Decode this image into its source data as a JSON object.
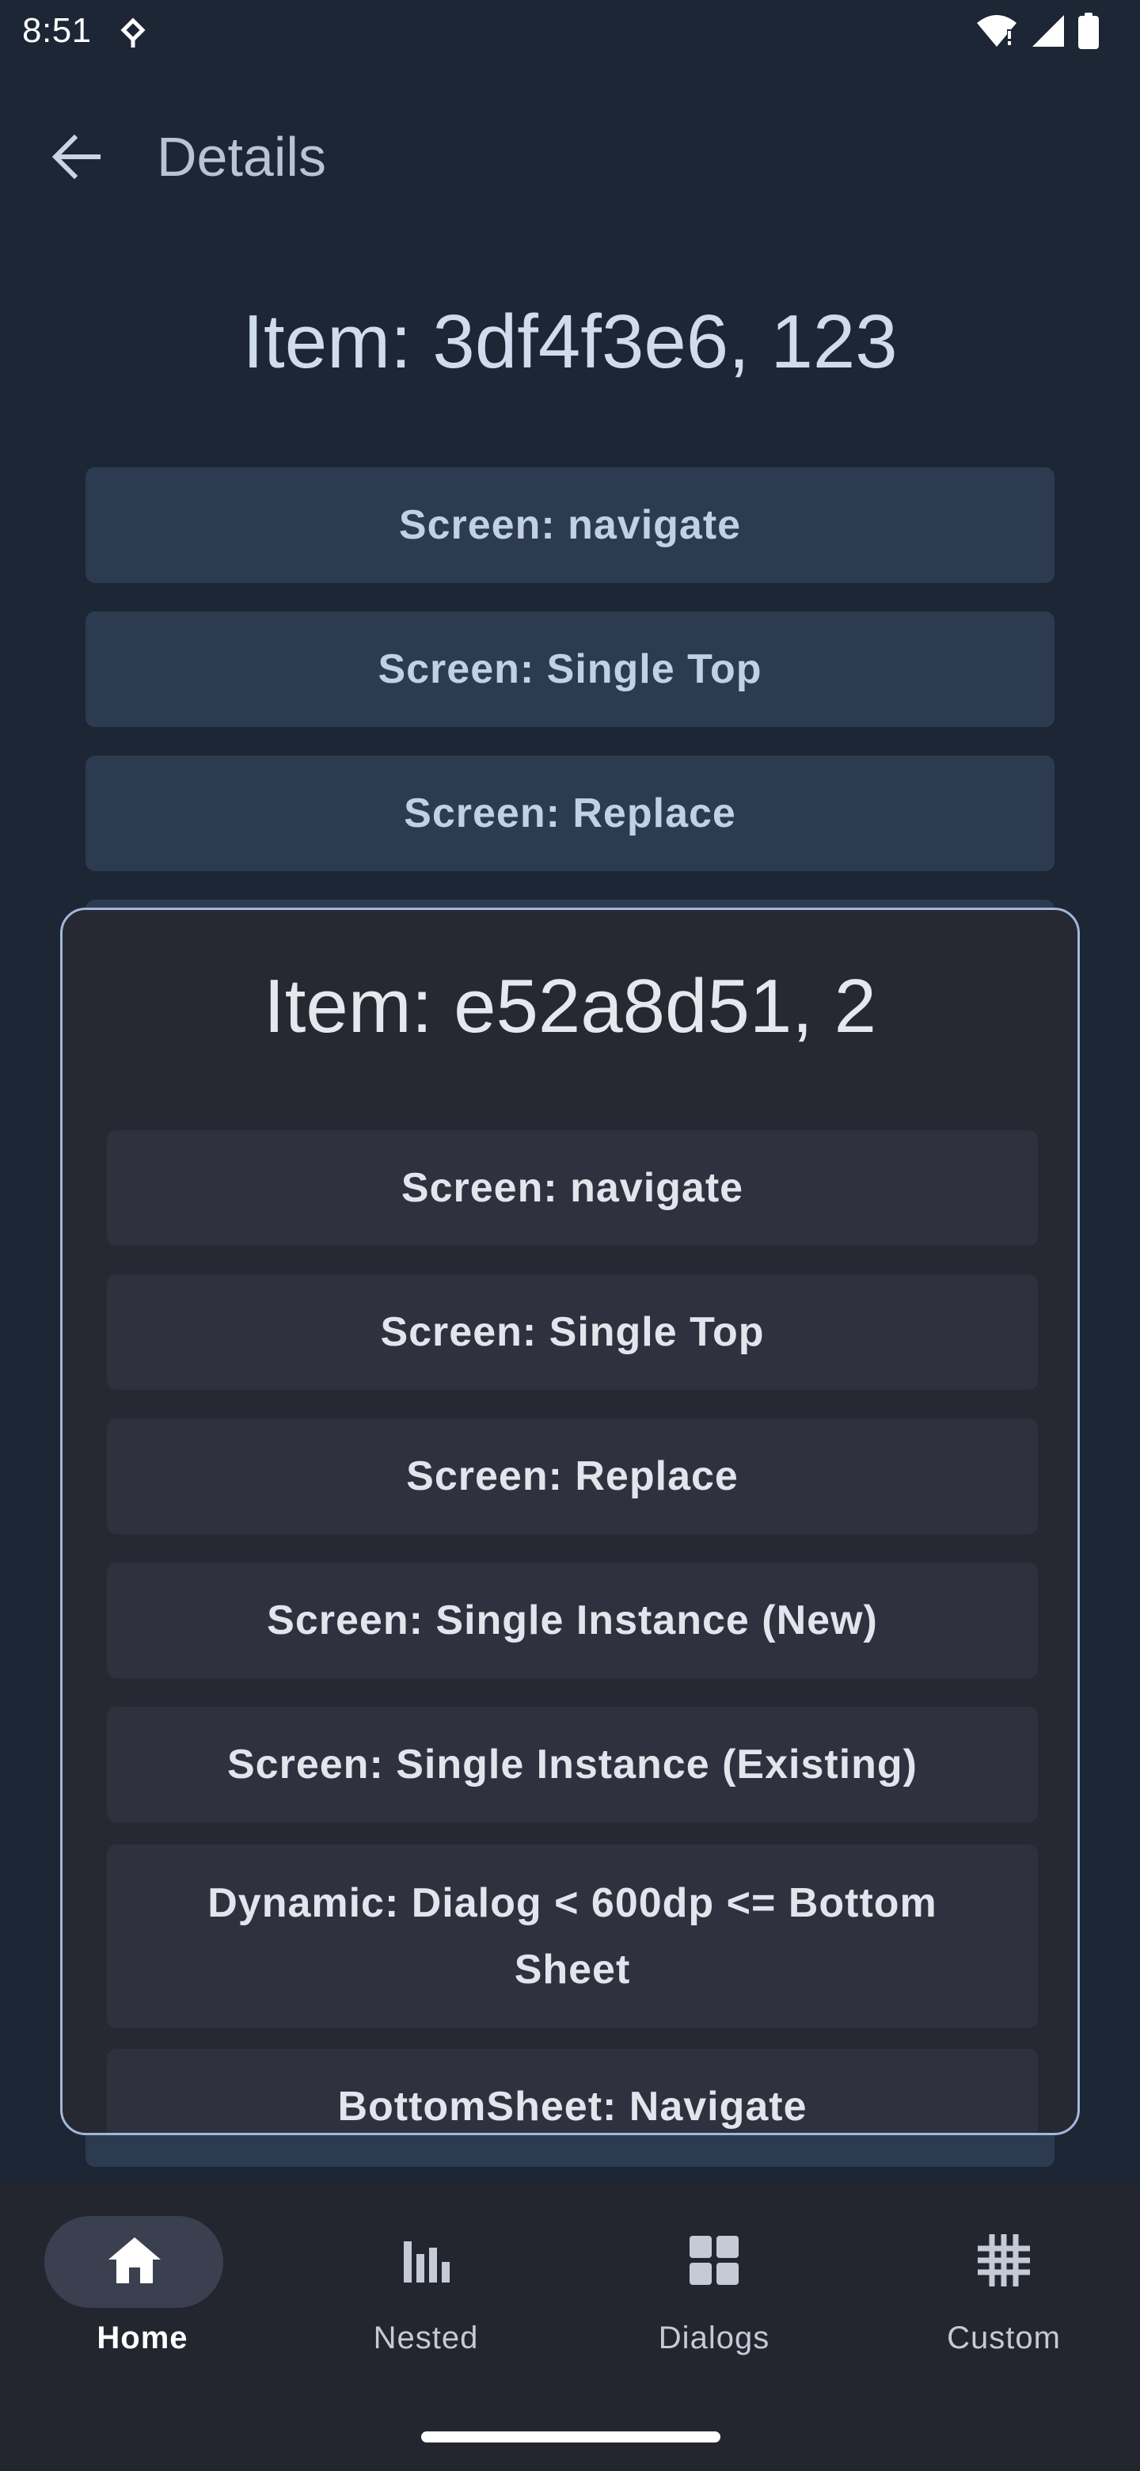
{
  "status_bar": {
    "time": "8:51",
    "icons": [
      "data-transfer-icon",
      "wifi-icon",
      "signal-icon",
      "battery-icon"
    ]
  },
  "app_bar": {
    "title": "Details",
    "back_icon": "arrow-back-icon"
  },
  "background_screen": {
    "title": "Item: 3df4f3e6, 123",
    "buttons": [
      {
        "label": "Screen: navigate"
      },
      {
        "label": "Screen: Single Top"
      },
      {
        "label": "Screen: Replace"
      }
    ]
  },
  "dialog": {
    "title": "Item: e52a8d51, 2",
    "buttons": [
      {
        "label": "Screen: navigate"
      },
      {
        "label": "Screen: Single Top"
      },
      {
        "label": "Screen: Replace"
      },
      {
        "label": "Screen: Single Instance (New)"
      },
      {
        "label": "Screen: Single Instance (Existing)"
      },
      {
        "label": "Dynamic: Dialog < 600dp <= Bottom Sheet"
      },
      {
        "label": "BottomSheet: Navigate"
      }
    ]
  },
  "bottom_nav": {
    "items": [
      {
        "label": "Home",
        "icon": "home-icon",
        "active": true
      },
      {
        "label": "Nested",
        "icon": "bar-chart-icon",
        "active": false
      },
      {
        "label": "Dialogs",
        "icon": "grid-icon",
        "active": false
      },
      {
        "label": "Custom",
        "icon": "hashtag-grid-icon",
        "active": false
      }
    ]
  },
  "colors": {
    "background": "#1c2634",
    "background_button": "#2d3b51",
    "dialog_surface": "#262932",
    "dialog_border": "#a3b7dc",
    "dialog_button": "#2f323e",
    "nav_background": "#23262f",
    "nav_active_pill": "#3b4050"
  }
}
